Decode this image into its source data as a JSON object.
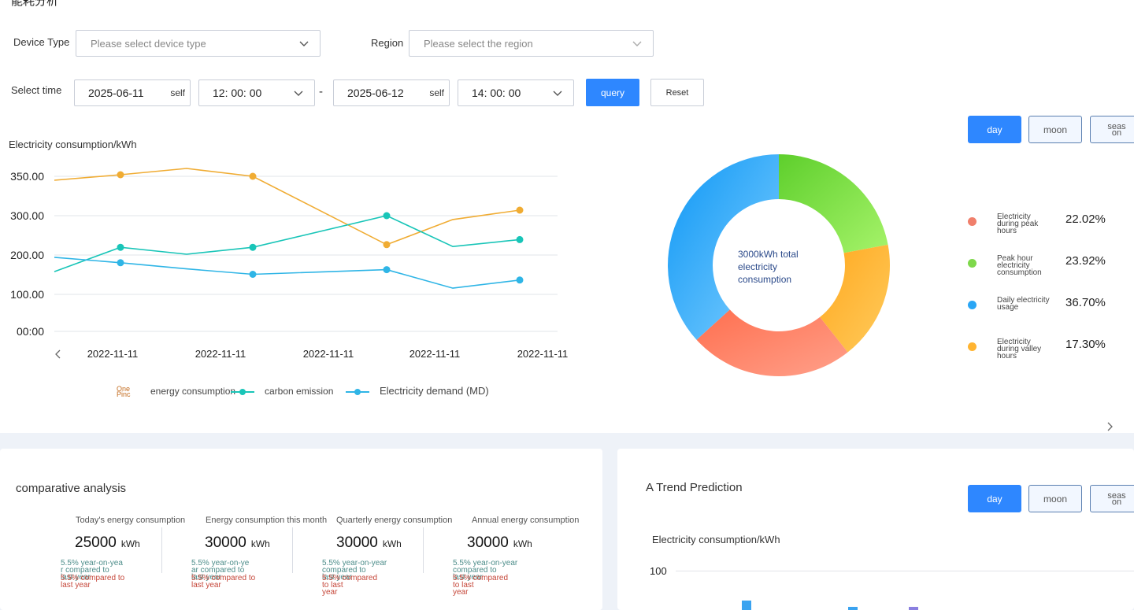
{
  "page": {
    "title": "能耗分析"
  },
  "filters": {
    "device_type_label": "Device Type",
    "device_type_placeholder": "Please select device type",
    "region_label": "Region",
    "region_placeholder": "Please select the region",
    "time_label": "Select time",
    "start_date": "2025-06-11",
    "start_date_suffix": "self",
    "start_time": "12: 00: 00",
    "range_separator": "-",
    "end_date": "2025-06-12",
    "end_date_suffix": "self",
    "end_time": "14: 00: 00",
    "query_label": "query",
    "reset_label": "Reset"
  },
  "period_tabs": {
    "day": "day",
    "moon": "moon",
    "season": [
      "seas",
      "on"
    ]
  },
  "line_chart": {
    "ylabel": "Electricity consumption/kWh",
    "legend": [
      {
        "name": "energy consumption",
        "prefix": [
          "One",
          "Pinc"
        ],
        "color": "#f0ac33"
      },
      {
        "name": "carbon emission",
        "color": "#19c5b8"
      },
      {
        "name": "Electricity demand (MD)",
        "color": "#2fb5e6"
      }
    ]
  },
  "chart_data": [
    {
      "type": "line",
      "ylabel": "Electricity consumption/kWh",
      "y_tick_labels": [
        "00:00",
        "100.00",
        "200.00",
        "300.00",
        "350.00"
      ],
      "x_tick_labels": [
        "2022-11-11",
        "2022-11-11",
        "2022-11-11",
        "2022-11-11",
        "2022-11-11"
      ],
      "grid": true,
      "legend_position": "bottom",
      "series": [
        {
          "name": "energy consumption",
          "color": "#f0ac33",
          "values": [
            345,
            352,
            360,
            350,
            225,
            290,
            307
          ]
        },
        {
          "name": "carbon emission",
          "color": "#19c5b8",
          "values": [
            155,
            218,
            200,
            218,
            300,
            220,
            238
          ]
        },
        {
          "name": "Electricity demand (MD)",
          "color": "#2fb5e6",
          "values": [
            192,
            178,
            162,
            148,
            160,
            112,
            133
          ]
        }
      ],
      "markers": {
        "energy consumption": [
          1,
          3,
          4,
          6
        ],
        "carbon emission": [
          1,
          3,
          4,
          6
        ],
        "Electricity demand (MD)": [
          1,
          3,
          4,
          6
        ]
      }
    },
    {
      "type": "pie",
      "center_label": [
        "3000kWh total",
        "electricity",
        "consumption"
      ],
      "slices": [
        {
          "name": "Electricity during peak hours",
          "name_lines": [
            "Electricity",
            "during peak",
            "hours"
          ],
          "value": 22.02,
          "label": "22.02%",
          "color": "#7ed84b",
          "dot_color": "#f07f6b"
        },
        {
          "name": "Peak hour electricity consumption",
          "name_lines": [
            "Peak hour",
            "electricity",
            "consumption"
          ],
          "value": 23.92,
          "label": "23.92%",
          "color": "#ff8a6b",
          "dot_color": "#7ed84b"
        },
        {
          "name": "Daily electricity usage",
          "name_lines": [
            "Daily electricity",
            "usage"
          ],
          "value": 36.7,
          "label": "36.70%",
          "color": "#2aa6f5",
          "dot_color": "#2aa6f5"
        },
        {
          "name": "Electricity during valley hours",
          "name_lines": [
            "Electricity",
            "during valley",
            "hours"
          ],
          "value": 17.3,
          "label": "17.30%",
          "color": "#ffb431",
          "dot_color": "#ffb431"
        }
      ]
    },
    {
      "type": "bar",
      "ylabel": "Electricity consumption/kWh",
      "y_tick_labels": [
        "100"
      ]
    }
  ],
  "comparative": {
    "title": "comparative analysis",
    "stats": [
      {
        "label": "Today's energy consumption",
        "value": "25000",
        "unit": "kWh",
        "yoy": [
          "5.5% year-on-yea",
          "r compared to",
          "last year"
        ],
        "cmp": [
          "5.5% compared to",
          "last year"
        ]
      },
      {
        "label": "Energy consumption this month",
        "value": "30000",
        "unit": "kWh",
        "yoy": [
          "5.5% year-on-ye",
          "ar compared to",
          "last year"
        ],
        "cmp": [
          "5.5% compared to",
          "last year"
        ]
      },
      {
        "label": "Quarterly energy consumption",
        "value": "30000",
        "unit": "kWh",
        "yoy": [
          "5.5% year-on-year",
          "compared to",
          "last year"
        ],
        "cmp": [
          "5.5% compared",
          "to last",
          "year"
        ]
      },
      {
        "label": "Annual energy consumption",
        "value": "30000",
        "unit": "kWh",
        "yoy": [
          "5.5% year-on-year",
          "compared to",
          "last year"
        ],
        "cmp": [
          "5.5% compared",
          "to last",
          "year"
        ]
      }
    ]
  },
  "trend": {
    "title": "A Trend Prediction",
    "ylabel": "Electricity consumption/kWh",
    "ytick": "100"
  }
}
